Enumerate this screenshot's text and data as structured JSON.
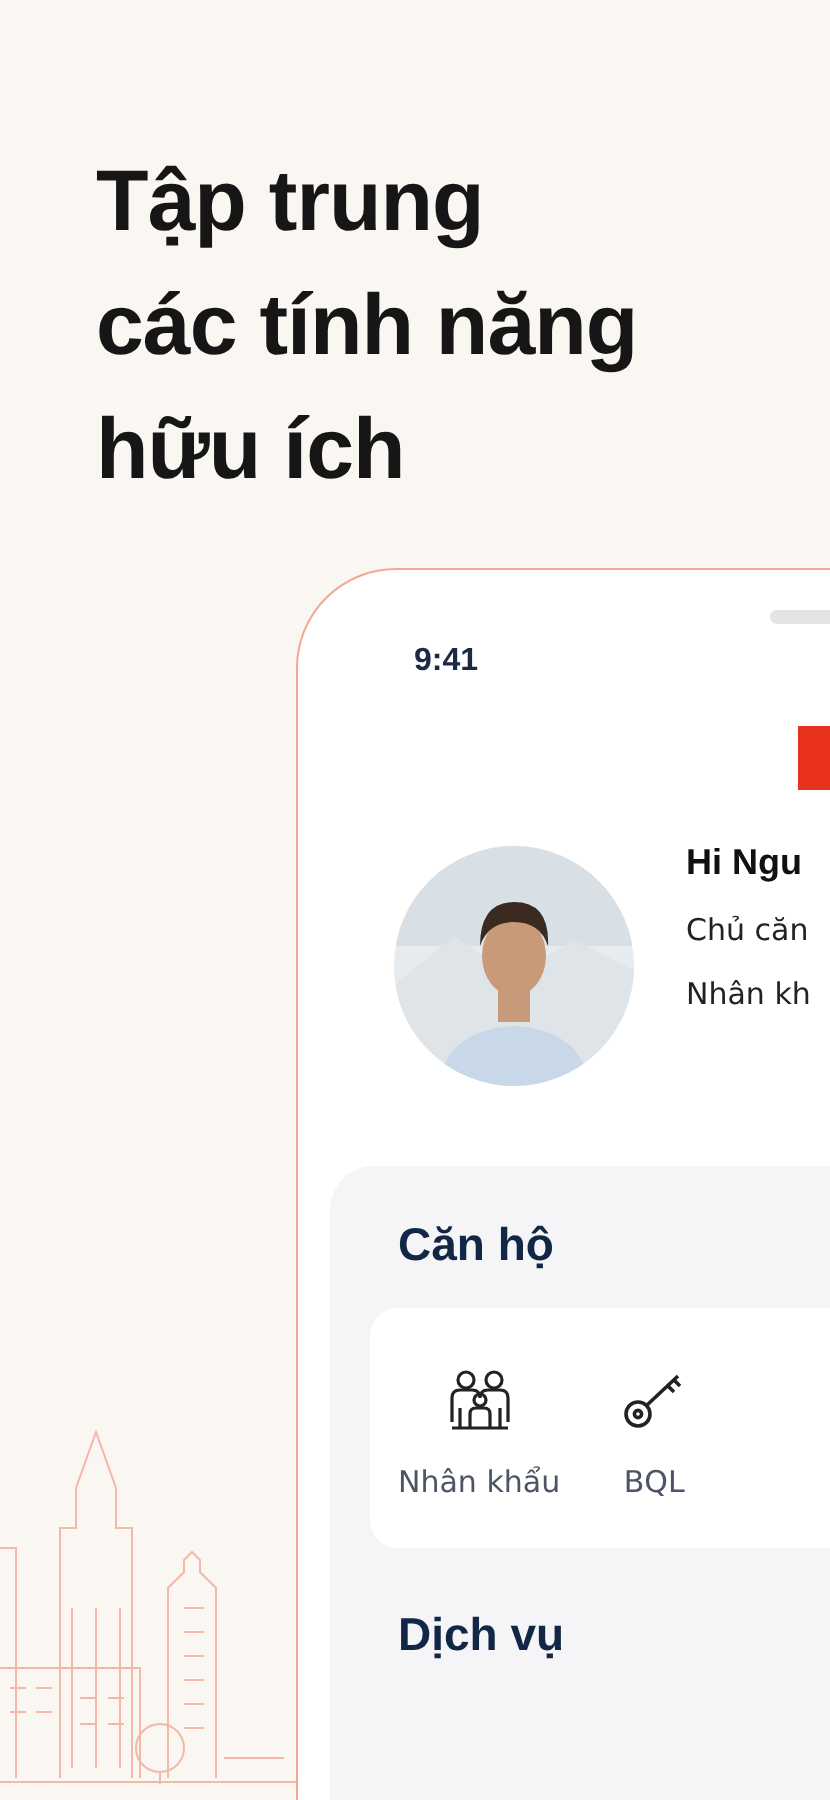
{
  "headline": [
    "Tập trung",
    "các tính năng",
    "hữu ích"
  ],
  "phone": {
    "status_time": "9:41",
    "profile": {
      "avatar": {
        "kind": "picture"
      },
      "greeting": "Hi Ngu",
      "lines": [
        "Chủ căn",
        "Nhân kh"
      ]
    },
    "sections": [
      {
        "title": "Căn hộ",
        "items": [
          {
            "kind": "family",
            "label": "Nhân khẩu"
          },
          {
            "kind": "key",
            "label": "BQL"
          }
        ]
      },
      {
        "title": "Dịch vụ"
      }
    ]
  }
}
